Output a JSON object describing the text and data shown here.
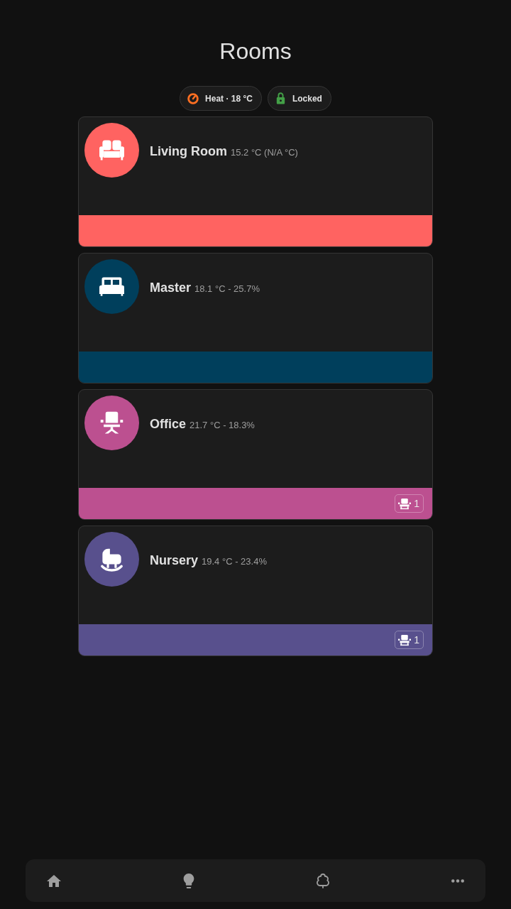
{
  "title": "Rooms",
  "chips": [
    {
      "kind": "thermostat",
      "label": "Heat · 18 °C",
      "color": "#ff6f22"
    },
    {
      "kind": "lock",
      "label": "Locked",
      "color": "#43a047"
    }
  ],
  "rooms": [
    {
      "kind": "sofa",
      "name": "Living Room",
      "reading": "15.2 °C (N/A °C)",
      "color": "#ff6361"
    },
    {
      "kind": "bed",
      "name": "Master",
      "reading": "18.1 °C - 25.7%",
      "color": "#003f5c"
    },
    {
      "kind": "desk-chair",
      "name": "Office",
      "reading": "21.7 °C - 18.3%",
      "color": "#bc5090",
      "occupancy": "1"
    },
    {
      "kind": "cradle",
      "name": "Nursery",
      "reading": "19.4 °C - 23.4%",
      "color": "#58508d",
      "occupancy": "1"
    }
  ],
  "nav": [
    {
      "kind": "home"
    },
    {
      "kind": "bulb"
    },
    {
      "kind": "tree"
    },
    {
      "kind": "more"
    }
  ]
}
